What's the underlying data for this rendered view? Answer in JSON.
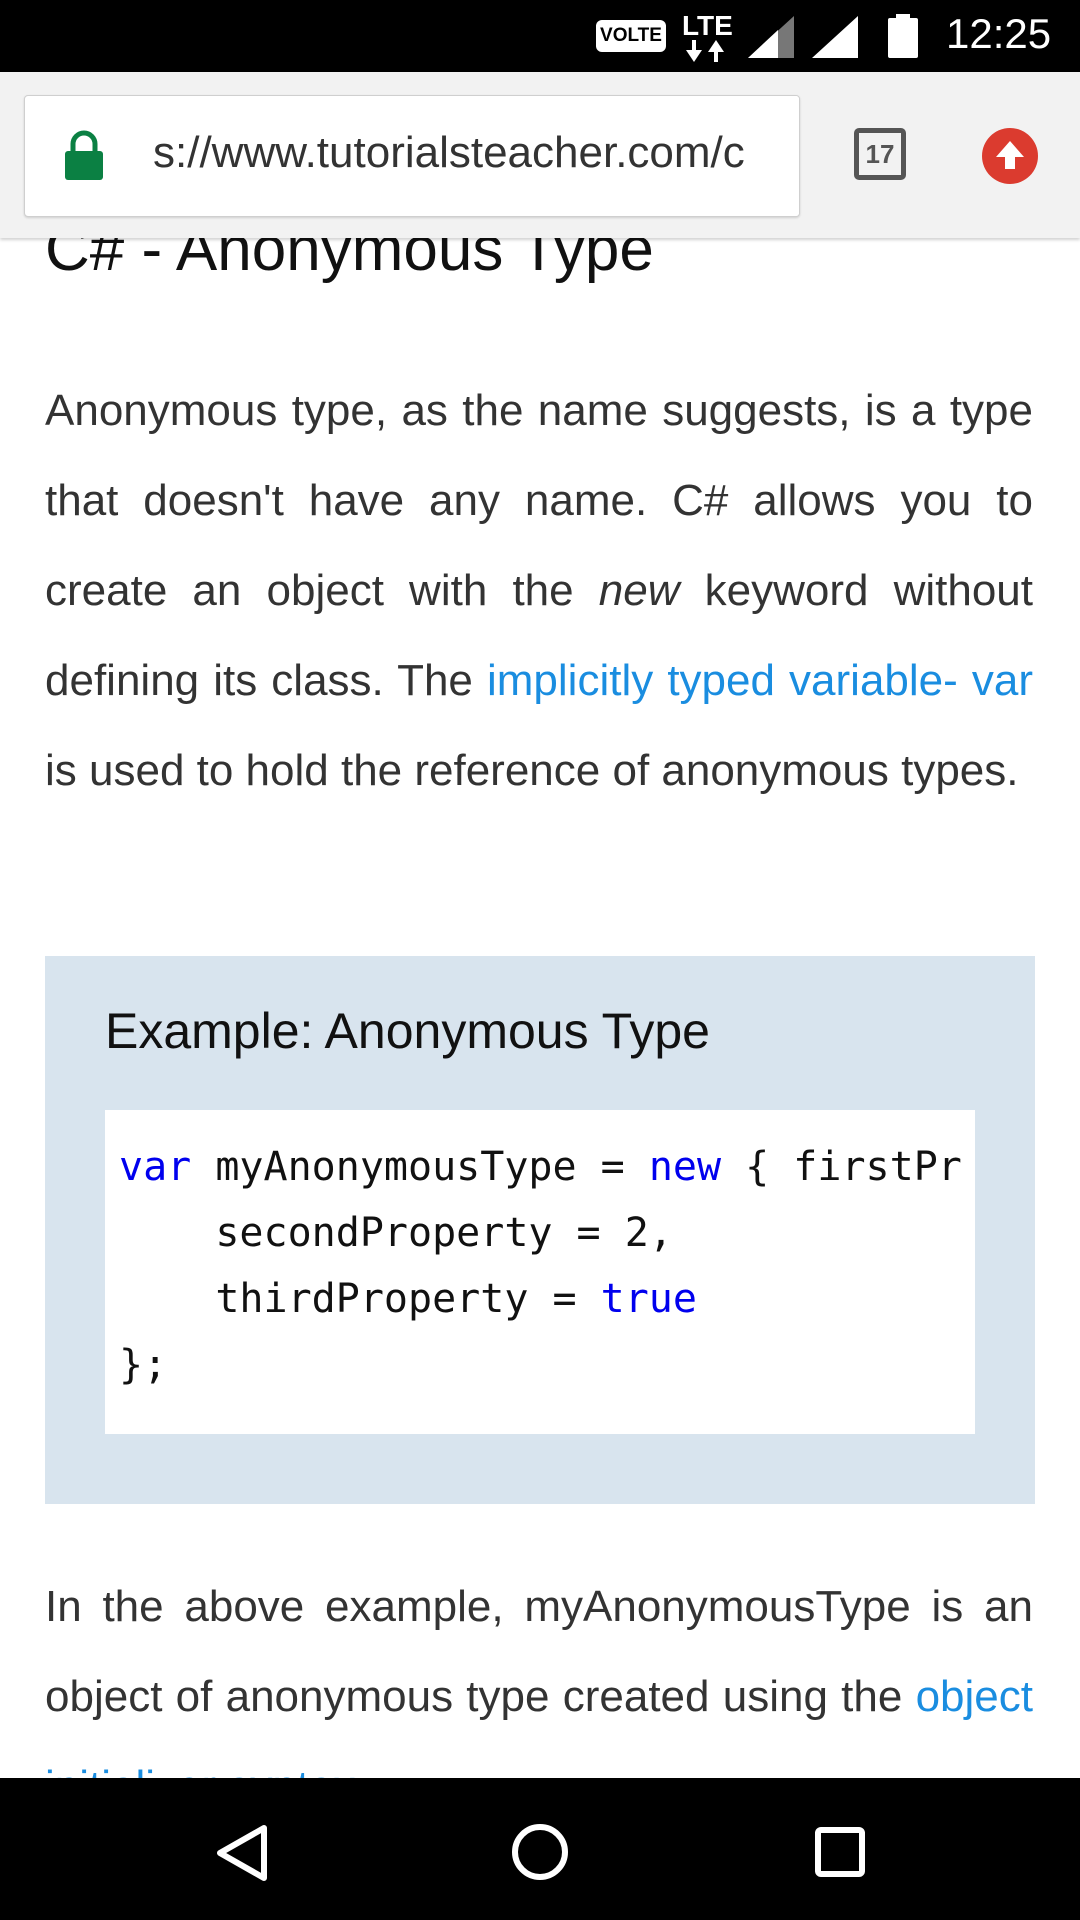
{
  "status_bar": {
    "volte_label": "VOLTE",
    "network_label": "LTE",
    "time": "12:25"
  },
  "browser": {
    "url": "s://www.tutorialsteacher.com/c",
    "tab_count": "17"
  },
  "article": {
    "title": "C# - Anonymous Type",
    "para1_part1": "Anonymous type, as the name suggests, is a type that doesn't have any name. C# allows you to create an object with the ",
    "para1_em": "new",
    "para1_part2": " keyword without defining its class. The ",
    "para1_link": "implicitly typed variable- var",
    "para1_part3": " is used to hold the reference of anonymous types.",
    "example_title": "Example: Anonymous Type",
    "code": {
      "line1_kw1": "var",
      "line1_mid": " myAnonymousType = ",
      "line1_kw2": "new",
      "line1_end": " { firstPr",
      "line2": "    secondProperty = 2,",
      "line3_start": "    thirdProperty = ",
      "line3_kw": "true",
      "line4": "};"
    },
    "para2_text": "In the above example, myAnonymousType is an object of anonymous type created using the",
    "para2_partial_link": "object initializer syntax"
  }
}
